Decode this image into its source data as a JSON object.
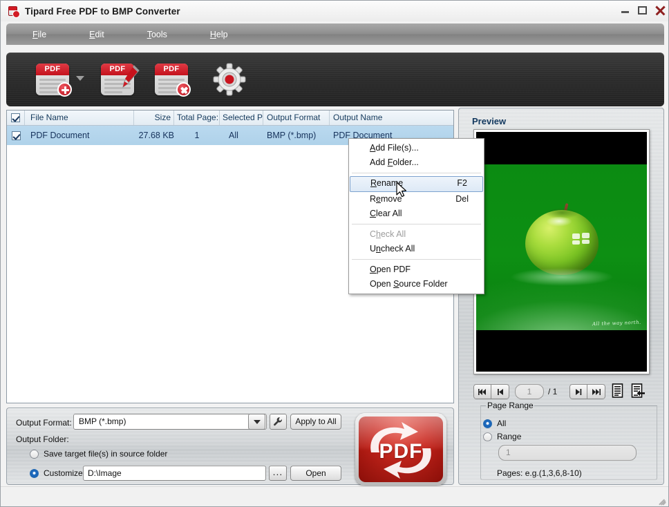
{
  "window": {
    "title": "Tipard Free PDF to BMP Converter",
    "icon": "pdf-app-icon",
    "controls": {
      "minimize": "minimize-icon",
      "maximize": "maximize-icon",
      "close": "close-icon"
    }
  },
  "menubar": {
    "items": [
      {
        "label": "File",
        "mnemonic": "F",
        "rest": "ile"
      },
      {
        "label": "Edit",
        "mnemonic": "E",
        "rest": "dit"
      },
      {
        "label": "Tools",
        "mnemonic": "T",
        "rest": "ools"
      },
      {
        "label": "Help",
        "mnemonic": "H",
        "rest": "elp"
      }
    ]
  },
  "toolbar": {
    "buttons": [
      {
        "name": "add-pdf-button",
        "caption": "PDF",
        "badge": "plus",
        "has_dropdown": true
      },
      {
        "name": "rename-pdf-button",
        "caption": "PDF",
        "badge": "pen",
        "has_dropdown": false
      },
      {
        "name": "remove-pdf-button",
        "caption": "PDF",
        "badge": "cross",
        "has_dropdown": false
      },
      {
        "name": "settings-gear-button",
        "caption": "",
        "badge": "gear",
        "has_dropdown": false
      }
    ]
  },
  "filelist": {
    "columns": [
      {
        "key": "check",
        "label": ""
      },
      {
        "key": "name",
        "label": "File Name"
      },
      {
        "key": "size",
        "label": "Size"
      },
      {
        "key": "total",
        "label": "Total Page:"
      },
      {
        "key": "selected",
        "label": "Selected P:"
      },
      {
        "key": "format",
        "label": "Output Format"
      },
      {
        "key": "output",
        "label": "Output Name"
      }
    ],
    "header_checkbox_checked": true,
    "rows": [
      {
        "checked": true,
        "name": "PDF Document",
        "size": "27.68 KB",
        "total": "1",
        "selected": "All",
        "format": "BMP (*.bmp)",
        "output": "PDF Document"
      }
    ]
  },
  "context_menu": {
    "items": [
      {
        "type": "item",
        "label": "Add File(s)...",
        "mnemonic": "A",
        "pre": "",
        "post": "dd File(s)...",
        "accel": "",
        "disabled": false,
        "highlight": false
      },
      {
        "type": "item",
        "label": "Add Folder...",
        "mnemonic": "F",
        "pre": "Add ",
        "post": "older...",
        "accel": "",
        "disabled": false,
        "highlight": false
      },
      {
        "type": "separator"
      },
      {
        "type": "item",
        "label": "Rename",
        "mnemonic": "R",
        "pre": "",
        "post": "ename",
        "accel": "F2",
        "disabled": false,
        "highlight": true
      },
      {
        "type": "item",
        "label": "Remove",
        "mnemonic": "e",
        "pre": "R",
        "post": "move",
        "accel": "Del",
        "disabled": false,
        "highlight": false
      },
      {
        "type": "item",
        "label": "Clear All",
        "mnemonic": "C",
        "pre": "",
        "post": "lear All",
        "accel": "",
        "disabled": false,
        "highlight": false
      },
      {
        "type": "separator"
      },
      {
        "type": "item",
        "label": "Check All",
        "mnemonic": "h",
        "pre": "C",
        "post": "eck All",
        "accel": "",
        "disabled": true,
        "highlight": false
      },
      {
        "type": "item",
        "label": "Uncheck All",
        "mnemonic": "n",
        "pre": "U",
        "post": "check All",
        "accel": "",
        "disabled": false,
        "highlight": false
      },
      {
        "type": "separator"
      },
      {
        "type": "item",
        "label": "Open PDF",
        "mnemonic": "O",
        "pre": "",
        "post": "pen PDF",
        "accel": "",
        "disabled": false,
        "highlight": false
      },
      {
        "type": "item",
        "label": "Open Source Folder",
        "mnemonic": "S",
        "pre": "Open ",
        "post": "ource Folder",
        "accel": "",
        "disabled": false,
        "highlight": false
      }
    ]
  },
  "output": {
    "format_label": "Output Format:",
    "format_value": "BMP (*.bmp)",
    "dropdown_icon": "chevron-down-icon",
    "settings_icon": "wrench-icon",
    "apply_label": "Apply to All",
    "folder_label": "Output Folder:",
    "source_radio_label": "Save target file(s) in source folder",
    "source_radio_selected": false,
    "customize_radio_label": "Customize:",
    "customize_radio_selected": true,
    "customize_path": "D:\\Image",
    "browse_label": "...",
    "open_label": "Open"
  },
  "convert": {
    "label": "PDF",
    "name": "convert-button"
  },
  "preview": {
    "title": "Preview",
    "image": {
      "signature": "All the way north.",
      "background_color": "#0d8f13",
      "letterbox_color": "#000000"
    },
    "nav": {
      "first": "first-page-icon",
      "prev": "previous-page-icon",
      "page_value": "1",
      "page_total": "/ 1",
      "next": "next-page-icon",
      "last": "last-page-icon",
      "doc_icon": "document-icon",
      "doc_export_icon": "document-export-icon"
    },
    "page_range": {
      "legend": "Page Range",
      "all_label": "All",
      "all_selected": true,
      "range_label": "Range",
      "range_selected": false,
      "range_value": "1",
      "hint": "Pages: e.g.(1,3,6,8-10)"
    }
  }
}
